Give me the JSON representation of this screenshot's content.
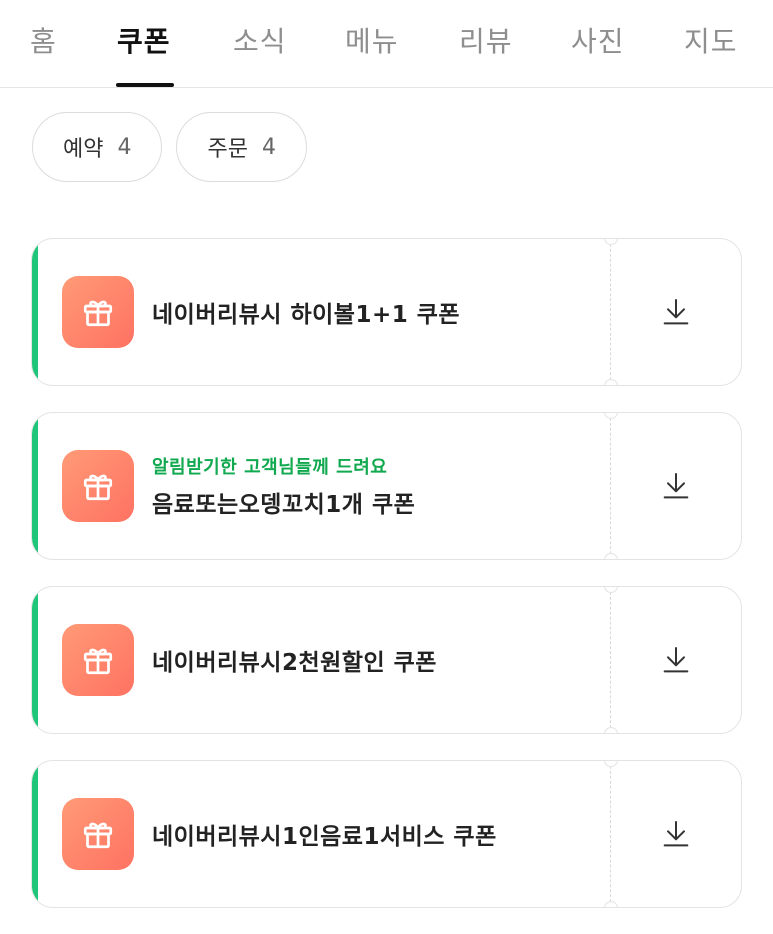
{
  "tabs": [
    {
      "label": "홈"
    },
    {
      "label": "쿠폰"
    },
    {
      "label": "소식"
    },
    {
      "label": "메뉴"
    },
    {
      "label": "리뷰"
    },
    {
      "label": "사진"
    },
    {
      "label": "지도"
    }
  ],
  "active_tab": "쿠폰",
  "filters": [
    {
      "label": "예약",
      "count": "4"
    },
    {
      "label": "주문",
      "count": "4"
    }
  ],
  "coupons": [
    {
      "subtitle": "",
      "title": "네이버리뷰시 하이볼1+1 쿠폰",
      "icon": "gift-icon",
      "action_icon": "download-icon"
    },
    {
      "subtitle": "알림받기한 고객님들께 드려요",
      "title": "음료또는오뎅꼬치1개 쿠폰",
      "icon": "gift-icon",
      "action_icon": "download-icon"
    },
    {
      "subtitle": "",
      "title": "네이버리뷰시2천원할인 쿠폰",
      "icon": "gift-icon",
      "action_icon": "download-icon"
    },
    {
      "subtitle": "",
      "title": "네이버리뷰시1인음료1서비스 쿠폰",
      "icon": "gift-icon",
      "action_icon": "download-icon"
    }
  ],
  "colors": {
    "accent": "#1fc67a",
    "subtitle": "#10a94f",
    "gift_gradient_start": "#ff9a76",
    "gift_gradient_end": "#ff7262"
  }
}
